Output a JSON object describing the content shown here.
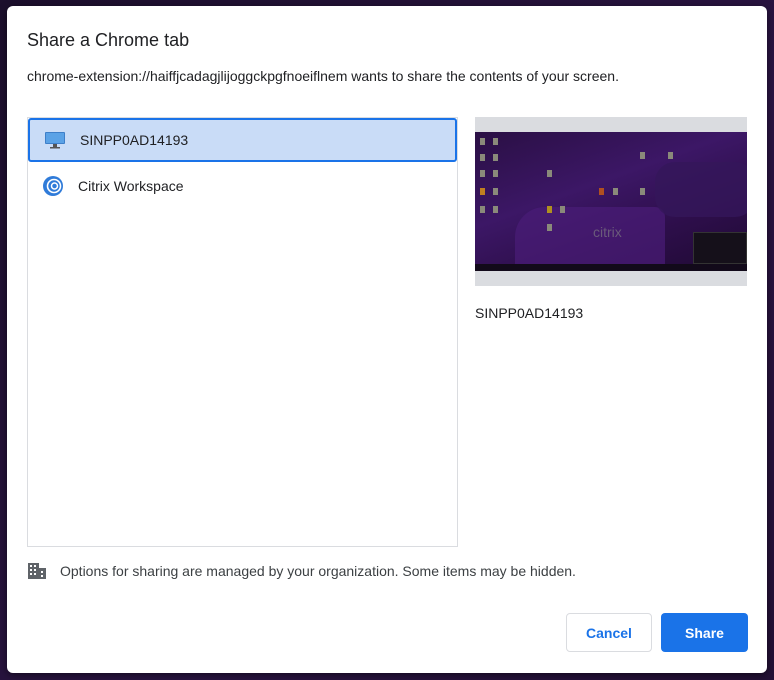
{
  "dialog": {
    "title": "Share a Chrome tab",
    "subtitle": "chrome-extension://haiffjcadagjlijoggckpgfnoeiflnem wants to share the contents of your screen."
  },
  "sources": [
    {
      "label": "SINPP0AD14193",
      "icon": "monitor-icon",
      "selected": true
    },
    {
      "label": "Citrix Workspace",
      "icon": "citrix-icon",
      "selected": false
    }
  ],
  "preview": {
    "label": "SINPP0AD14193",
    "watermark": "citrix"
  },
  "notice": "Options for sharing are managed by your organization. Some items may be hidden.",
  "buttons": {
    "cancel": "Cancel",
    "share": "Share"
  },
  "colors": {
    "accent": "#1a73e8",
    "selected_bg": "#c9dcf7"
  }
}
